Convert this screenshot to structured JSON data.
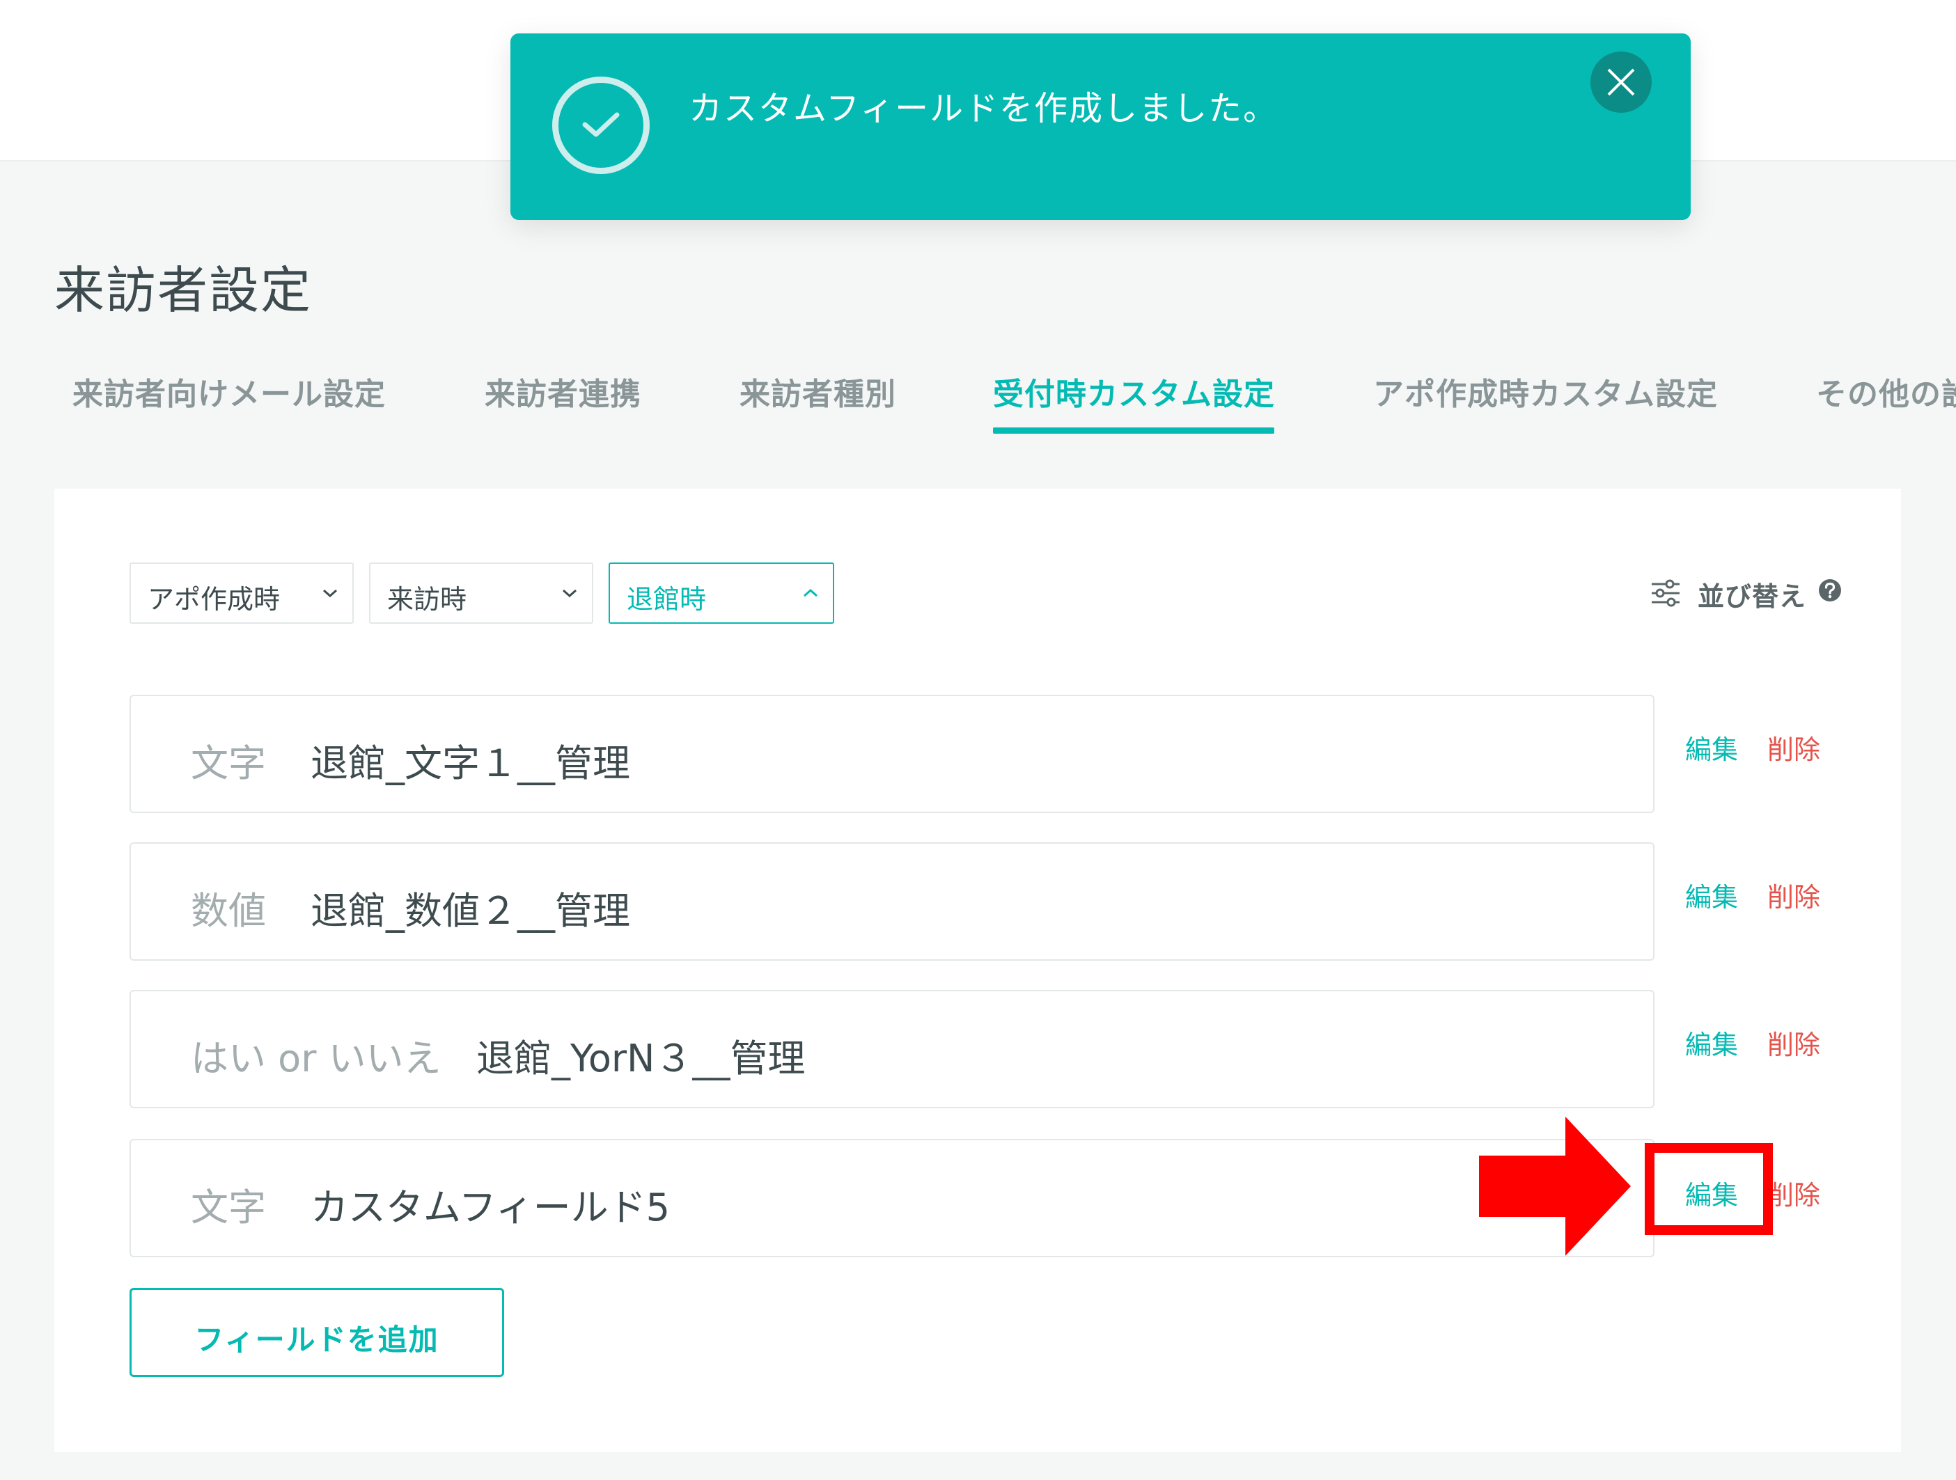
{
  "toast": {
    "message": "カスタムフィールドを作成しました。",
    "icon": "check-circle-icon",
    "close_icon": "close-icon",
    "color": "#04bab3"
  },
  "page_title": "来訪者設定",
  "tabs": [
    {
      "label": "来訪者向けメール設定",
      "active": false
    },
    {
      "label": "来訪者連携",
      "active": false
    },
    {
      "label": "来訪者種別",
      "active": false
    },
    {
      "label": "受付時カスタム設定",
      "active": true
    },
    {
      "label": "アポ作成時カスタム設定",
      "active": false
    },
    {
      "label": "その他の設",
      "active": false
    }
  ],
  "filters": [
    {
      "value": "アポ作成時",
      "open": false
    },
    {
      "value": "来訪時",
      "open": false
    },
    {
      "value": "退館時",
      "open": true
    }
  ],
  "sort": {
    "label": "並び替え",
    "icon": "sliders-icon",
    "help_icon": "help-icon"
  },
  "fields": [
    {
      "type": "文字",
      "name": "退館_文字１__管理"
    },
    {
      "type": "数値",
      "name": "退館_数値２__管理"
    },
    {
      "type": "はい or いいえ",
      "name": "退館_YorN３__管理"
    },
    {
      "type": "文字",
      "name": "カスタムフィールド5"
    }
  ],
  "actions": {
    "edit": "編集",
    "delete": "削除"
  },
  "add_button": {
    "label": "フィールドを追加"
  },
  "colors": {
    "accent": "#04bab3",
    "delete": "#e5534b",
    "annotation": "#ff0000"
  }
}
